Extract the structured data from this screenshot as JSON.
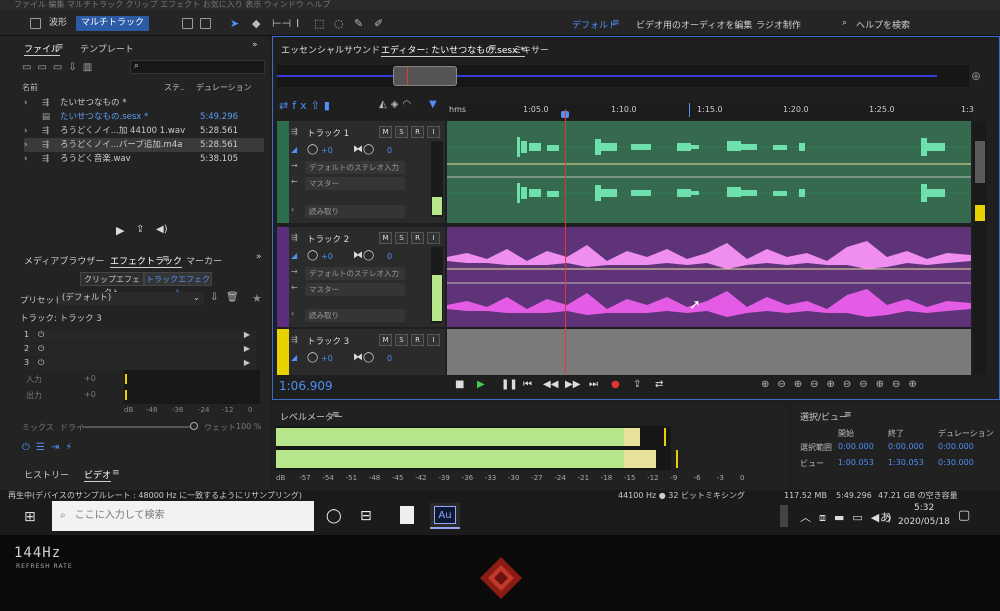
{
  "menubar": "ファイル 編集 マルチトラック クリップ エフェクト お気に入り 表示 ウィンドウ ヘルプ",
  "toolbar": {
    "waveform": "波形",
    "multitrack": "マルチトラック"
  },
  "workspaces": {
    "default": "デフォルト",
    "video_edit": "ビデオ用のオーディオを編集",
    "radio": "ラジオ制作",
    "help_search": "ヘルプを検索"
  },
  "files_panel": {
    "tab_files": "ファイル",
    "tab_templates": "テンプレート",
    "col_name": "名前",
    "col_status": "ステ..",
    "col_duration": "デュレーション",
    "rows": [
      {
        "name": "たいせつなもの *",
        "duration": ""
      },
      {
        "name": "たいせつなもの.sesx *",
        "duration": "5:49.296"
      },
      {
        "name": "ろうどくノイ...加 44100 1.wav",
        "duration": "5:28.561"
      },
      {
        "name": "ろうどくノイ...バーブ追加.m4a",
        "duration": "5:28.561"
      },
      {
        "name": "ろうどく音楽.wav",
        "duration": "5:38.105"
      }
    ]
  },
  "effects_panel": {
    "tab_media": "メディアブラウザー",
    "tab_effects": "エフェクトラック",
    "tab_markers": "マーカー",
    "clip_effects": "クリップエフェクト",
    "track_effects": "トラックエフェクト",
    "preset_label": "プリセット:",
    "preset_value": "(デフォルト)",
    "track_label": "トラック: トラック 3",
    "slots": [
      "1",
      "2",
      "3"
    ],
    "input": "入力",
    "output": "出力",
    "gain_in": "+0",
    "gain_out": "+0",
    "scale": [
      "dB",
      "-48",
      "-36",
      "-24",
      "-12",
      "0"
    ],
    "mix": "ミックス",
    "dry": "ドライ",
    "wet": "ウェット",
    "wet_value": "100 %"
  },
  "bottom_left": {
    "history": "ヒストリー",
    "video": "ビデオ"
  },
  "editor": {
    "tab_essential": "エッセンシャルサウンド",
    "tab_editor": "エディター: たいせつなもの.sesx *",
    "tab_mixer": "ミキサー",
    "timecode": "1:06.909",
    "ruler": [
      "hms",
      "1:05.0",
      "1:10.0",
      "1:15.0",
      "1:20.0",
      "1:25.0",
      "1:3"
    ],
    "tracks": [
      {
        "name": "トラック 1",
        "vol": "+0",
        "pan": "0",
        "input": "デフォルトのステレオ入力",
        "output": "マスター",
        "read": "読み取り",
        "color": "#49c48f"
      },
      {
        "name": "トラック 2",
        "vol": "+0",
        "pan": "0",
        "input": "デフォルトのステレオ入力",
        "output": "マスター",
        "read": "読み取り",
        "color": "#c04bd8"
      },
      {
        "name": "トラック 3",
        "vol": "+0",
        "pan": "0",
        "color": "#e7d200"
      }
    ],
    "msr": [
      "M",
      "S",
      "R",
      "I"
    ]
  },
  "level_meter": {
    "title": "レベルメーター",
    "scale": [
      "dB",
      "-57",
      "-54",
      "-51",
      "-48",
      "-45",
      "-42",
      "-39",
      "-36",
      "-33",
      "-30",
      "-27",
      "-24",
      "-21",
      "-18",
      "-15",
      "-12",
      "-9",
      "-6",
      "-3",
      "0"
    ]
  },
  "selection_view": {
    "title": "選択/ビュー",
    "col_start": "開始",
    "col_end": "終了",
    "col_duration": "デュレーション",
    "row_selection": "選択範囲",
    "row_view": "ビュー",
    "sel_start": "0:00.000",
    "sel_end": "0:00.000",
    "sel_dur": "0:00.000",
    "view_start": "1:00.053",
    "view_end": "1:30.053",
    "view_dur": "0:30.000"
  },
  "status": {
    "left": "再生中(デバイスのサンプルレート : 48000 Hz に一致するようにリサンプリング)",
    "format": "44100 Hz ● 32 ビットミキシング",
    "size": "117.52 MB",
    "duration": "5:49.296",
    "free": "47.21 GB の空き容量"
  },
  "taskbar": {
    "search_placeholder": "ここに入力して検索",
    "app_badge": "Au",
    "ime": "あ",
    "time": "5:32",
    "date": "2020/05/18"
  },
  "bezel": {
    "hz": "144Hz",
    "refresh": "REFRESH RATE"
  }
}
